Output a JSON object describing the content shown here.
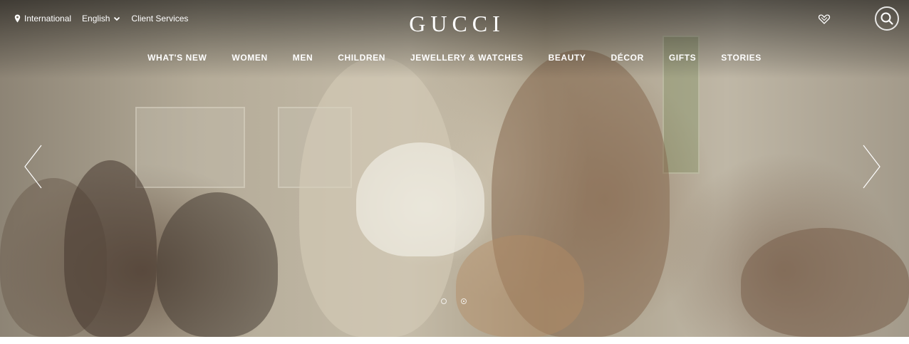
{
  "header": {
    "location_label": "International",
    "language_label": "English",
    "client_services_label": "Client Services",
    "logo_text": "GUCCI",
    "icons": {
      "location": "map-pin-icon",
      "language_caret": "chevron-down-icon",
      "wishlist": "heart-icon",
      "search": "search-icon"
    }
  },
  "nav": {
    "items": [
      {
        "label": "WHAT'S NEW"
      },
      {
        "label": "WOMEN"
      },
      {
        "label": "MEN"
      },
      {
        "label": "CHILDREN"
      },
      {
        "label": "JEWELLERY & WATCHES"
      },
      {
        "label": "BEAUTY"
      },
      {
        "label": "DÉCOR"
      },
      {
        "label": "GIFTS"
      },
      {
        "label": "STORIES"
      }
    ]
  },
  "hero": {
    "slide_count": 2,
    "active_slide": 2,
    "controls": {
      "prev": "chevron-left-icon",
      "next": "chevron-right-icon"
    }
  },
  "colors": {
    "header_text": "#ffffff",
    "page_background": "#ffffff"
  }
}
